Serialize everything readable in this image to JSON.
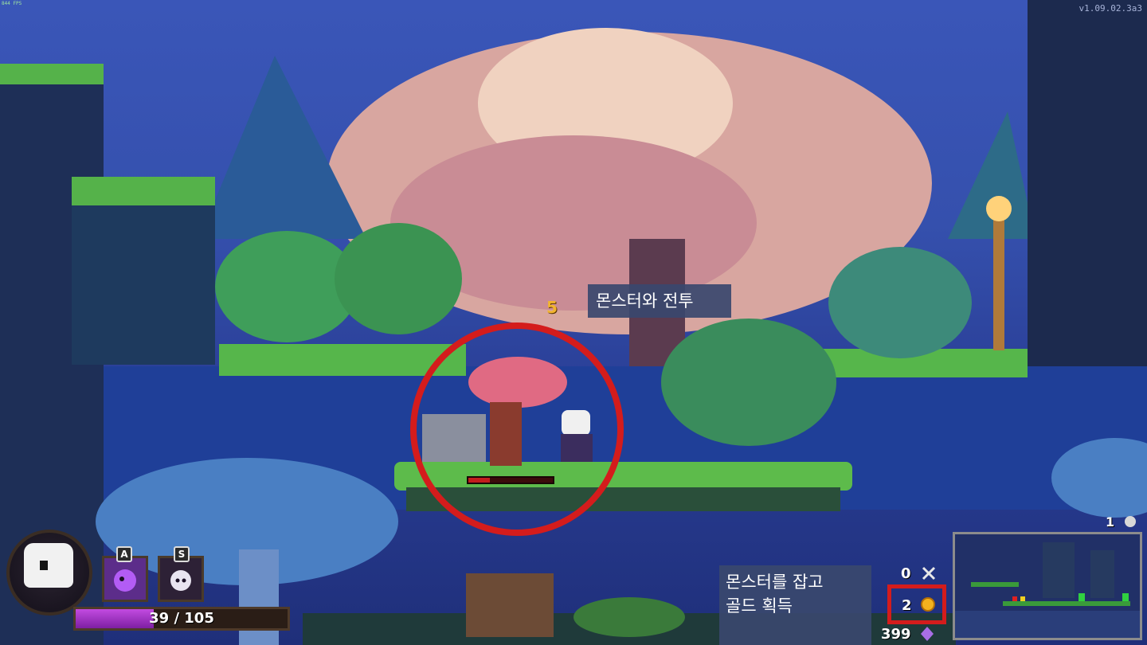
{
  "hud": {
    "fps": "844 FPS",
    "version": "v1.09.02.3a3",
    "damage_number": "5",
    "player_hp": "39 / 105",
    "player_hp_fraction": 0.37,
    "skill_key_a": "A",
    "skill_key_s": "S",
    "bone_count": "0",
    "gold_count": "2",
    "dark_quartz_count": "399",
    "minimap_count": "1",
    "enemy_hp_fraction": 0.25
  },
  "captions": {
    "fight": "몬스터와 전투",
    "gold": "몬스터를 잡고\n골드 획득"
  },
  "colors": {
    "highlight": "#d41c1c",
    "hp_bar": "#a335c9",
    "gold": "#f4b21e"
  }
}
